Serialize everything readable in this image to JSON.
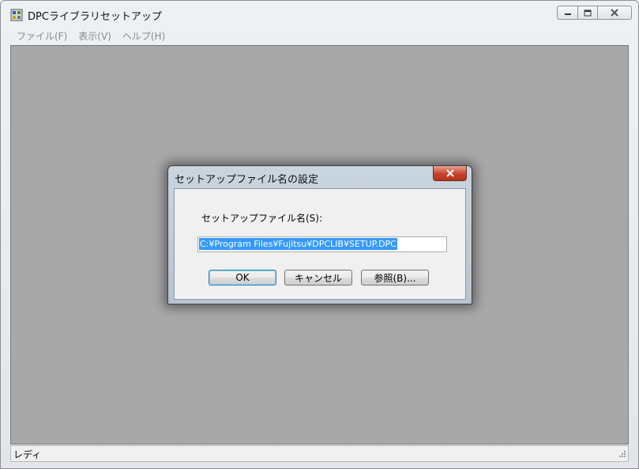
{
  "window": {
    "title": "DPCライブラリセットアップ"
  },
  "menu": {
    "items": [
      "ファイル(F)",
      "表示(V)",
      "ヘルプ(H)"
    ]
  },
  "statusbar": {
    "text": "レディ"
  },
  "dialog": {
    "title": "セットアップファイル名の設定",
    "label": "セットアップファイル名(S):",
    "input_value": "C:¥Program Files¥Fujitsu¥DPCLIB¥SETUP.DPC",
    "buttons": {
      "ok": "OK",
      "cancel": "キャンセル",
      "browse": "参照(B)..."
    }
  },
  "colors": {
    "client_background": "#a9a8a8",
    "selection": "#3399ff",
    "close_button": "#c7422a"
  },
  "icons": {
    "app": "app-icon",
    "minimize": "minimize-icon",
    "maximize": "maximize-icon",
    "close": "close-icon",
    "grip": "resize-grip-icon"
  }
}
